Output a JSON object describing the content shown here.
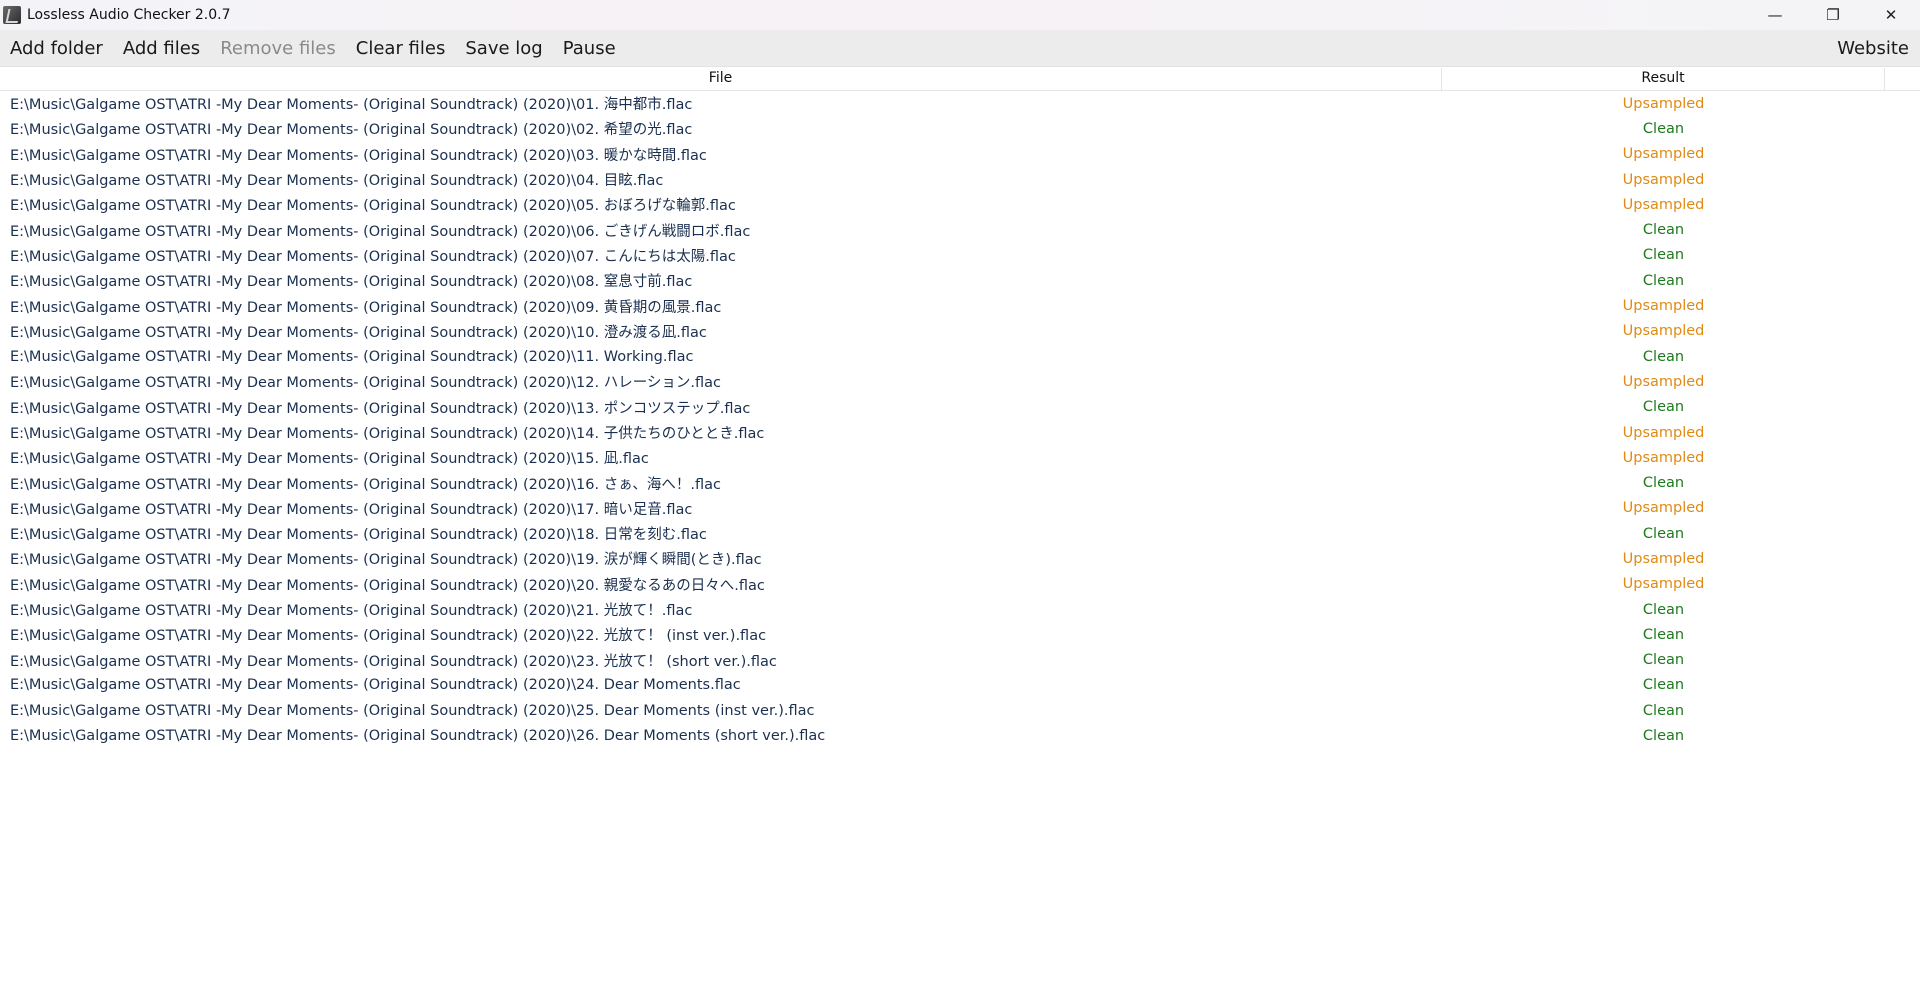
{
  "window": {
    "title": "Lossless Audio Checker 2.0.7",
    "icon": "app-icon",
    "controls": {
      "minimize": "—",
      "restore": "❐",
      "close": "✕"
    }
  },
  "toolbar": {
    "add_folder": "Add folder",
    "add_files": "Add files",
    "remove_files": "Remove files",
    "clear_files": "Clear files",
    "save_log": "Save log",
    "pause": "Pause",
    "website": "Website"
  },
  "colors": {
    "upsampled": "#e08a14",
    "clean": "#1e7a1e",
    "path_text": "#1b3050"
  },
  "table": {
    "columns": [
      "File",
      "Result"
    ],
    "rows": [
      {
        "file": "E:\\Music\\Galgame OST\\ATRI -My Dear Moments- (Original Soundtrack) (2020)\\01. 海中都市.flac",
        "result": "Upsampled"
      },
      {
        "file": "E:\\Music\\Galgame OST\\ATRI -My Dear Moments- (Original Soundtrack) (2020)\\02. 希望の光.flac",
        "result": "Clean"
      },
      {
        "file": "E:\\Music\\Galgame OST\\ATRI -My Dear Moments- (Original Soundtrack) (2020)\\03. 暖かな時間.flac",
        "result": "Upsampled"
      },
      {
        "file": "E:\\Music\\Galgame OST\\ATRI -My Dear Moments- (Original Soundtrack) (2020)\\04. 目眩.flac",
        "result": "Upsampled"
      },
      {
        "file": "E:\\Music\\Galgame OST\\ATRI -My Dear Moments- (Original Soundtrack) (2020)\\05. おぼろげな輪郭.flac",
        "result": "Upsampled"
      },
      {
        "file": "E:\\Music\\Galgame OST\\ATRI -My Dear Moments- (Original Soundtrack) (2020)\\06. ごきげん戦闘ロボ.flac",
        "result": "Clean"
      },
      {
        "file": "E:\\Music\\Galgame OST\\ATRI -My Dear Moments- (Original Soundtrack) (2020)\\07. こんにちは太陽.flac",
        "result": "Clean"
      },
      {
        "file": "E:\\Music\\Galgame OST\\ATRI -My Dear Moments- (Original Soundtrack) (2020)\\08. 窒息寸前.flac",
        "result": "Clean"
      },
      {
        "file": "E:\\Music\\Galgame OST\\ATRI -My Dear Moments- (Original Soundtrack) (2020)\\09. 黄昏期の風景.flac",
        "result": "Upsampled"
      },
      {
        "file": "E:\\Music\\Galgame OST\\ATRI -My Dear Moments- (Original Soundtrack) (2020)\\10. 澄み渡る凪.flac",
        "result": "Upsampled"
      },
      {
        "file": "E:\\Music\\Galgame OST\\ATRI -My Dear Moments- (Original Soundtrack) (2020)\\11. Working.flac",
        "result": "Clean"
      },
      {
        "file": "E:\\Music\\Galgame OST\\ATRI -My Dear Moments- (Original Soundtrack) (2020)\\12. ハレーション.flac",
        "result": "Upsampled"
      },
      {
        "file": "E:\\Music\\Galgame OST\\ATRI -My Dear Moments- (Original Soundtrack) (2020)\\13. ポンコツステップ.flac",
        "result": "Clean"
      },
      {
        "file": "E:\\Music\\Galgame OST\\ATRI -My Dear Moments- (Original Soundtrack) (2020)\\14. 子供たちのひととき.flac",
        "result": "Upsampled"
      },
      {
        "file": "E:\\Music\\Galgame OST\\ATRI -My Dear Moments- (Original Soundtrack) (2020)\\15. 凪.flac",
        "result": "Upsampled"
      },
      {
        "file": "E:\\Music\\Galgame OST\\ATRI -My Dear Moments- (Original Soundtrack) (2020)\\16. さぁ、海へ！.flac",
        "result": "Clean"
      },
      {
        "file": "E:\\Music\\Galgame OST\\ATRI -My Dear Moments- (Original Soundtrack) (2020)\\17. 暗い足音.flac",
        "result": "Upsampled"
      },
      {
        "file": "E:\\Music\\Galgame OST\\ATRI -My Dear Moments- (Original Soundtrack) (2020)\\18. 日常を刻む.flac",
        "result": "Clean"
      },
      {
        "file": "E:\\Music\\Galgame OST\\ATRI -My Dear Moments- (Original Soundtrack) (2020)\\19. 涙が輝く瞬間(とき).flac",
        "result": "Upsampled"
      },
      {
        "file": "E:\\Music\\Galgame OST\\ATRI -My Dear Moments- (Original Soundtrack) (2020)\\20. 親愛なるあの日々へ.flac",
        "result": "Upsampled"
      },
      {
        "file": "E:\\Music\\Galgame OST\\ATRI -My Dear Moments- (Original Soundtrack) (2020)\\21. 光放て！.flac",
        "result": "Clean"
      },
      {
        "file": "E:\\Music\\Galgame OST\\ATRI -My Dear Moments- (Original Soundtrack) (2020)\\22. 光放て！ (inst ver.).flac",
        "result": "Clean"
      },
      {
        "file": "E:\\Music\\Galgame OST\\ATRI -My Dear Moments- (Original Soundtrack) (2020)\\23. 光放て！ (short ver.).flac",
        "result": "Clean"
      },
      {
        "file": "E:\\Music\\Galgame OST\\ATRI -My Dear Moments- (Original Soundtrack) (2020)\\24. Dear Moments.flac",
        "result": "Clean"
      },
      {
        "file": "E:\\Music\\Galgame OST\\ATRI -My Dear Moments- (Original Soundtrack) (2020)\\25. Dear Moments (inst ver.).flac",
        "result": "Clean"
      },
      {
        "file": "E:\\Music\\Galgame OST\\ATRI -My Dear Moments- (Original Soundtrack) (2020)\\26. Dear Moments (short ver.).flac",
        "result": "Clean"
      }
    ]
  }
}
